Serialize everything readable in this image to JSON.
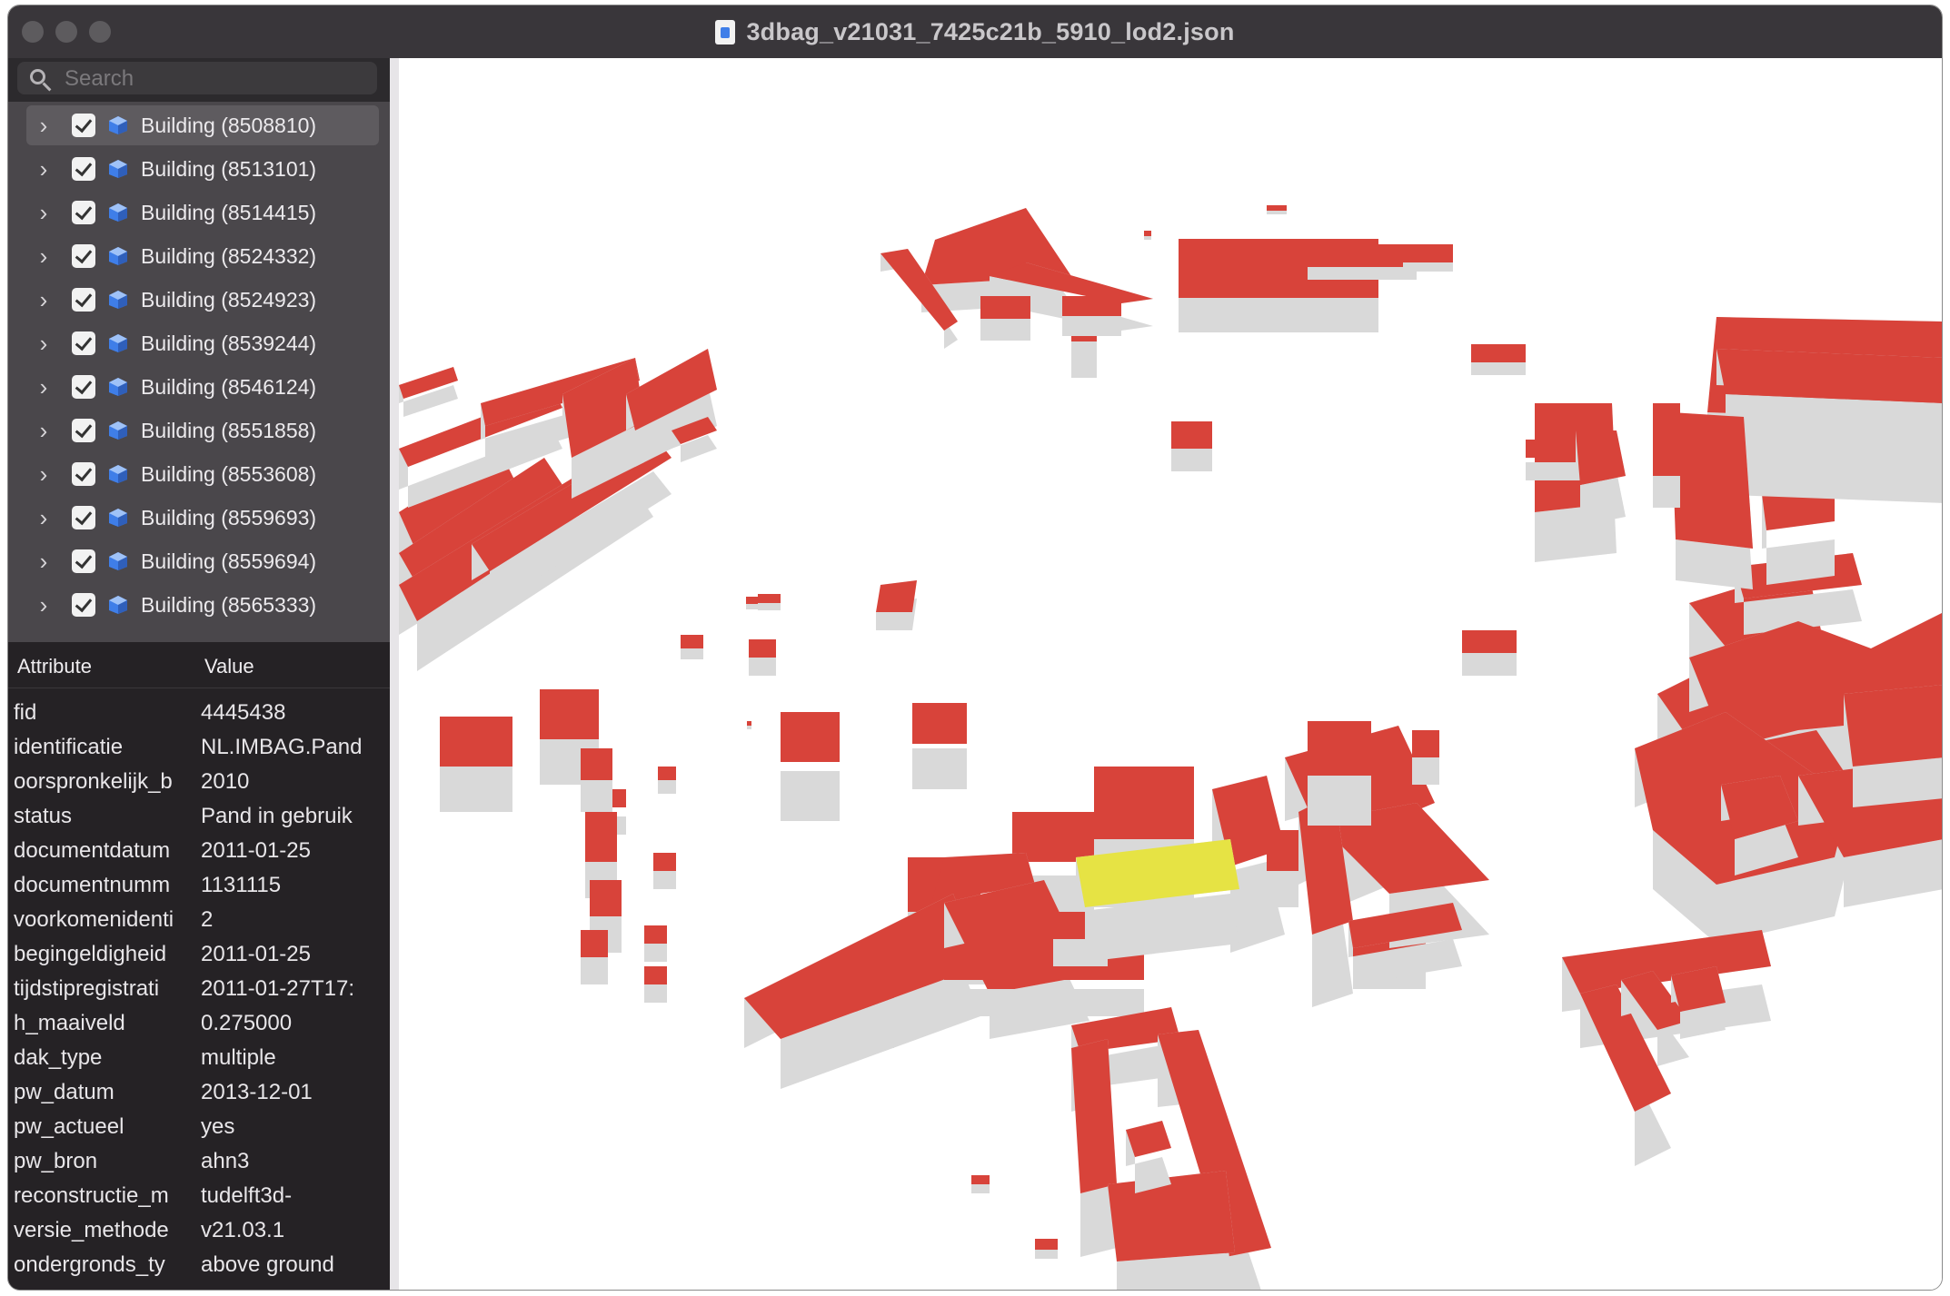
{
  "window": {
    "title": "3dbag_v21031_7425c21b_5910_lod2.json",
    "title_icon": "document-icon"
  },
  "search": {
    "placeholder": "Search",
    "value": ""
  },
  "tree": {
    "items": [
      {
        "label": "Building (8508810)",
        "checked": true,
        "selected": true
      },
      {
        "label": "Building (8513101)",
        "checked": true
      },
      {
        "label": "Building (8514415)",
        "checked": true
      },
      {
        "label": "Building (8524332)",
        "checked": true
      },
      {
        "label": "Building (8524923)",
        "checked": true
      },
      {
        "label": "Building (8539244)",
        "checked": true
      },
      {
        "label": "Building (8546124)",
        "checked": true
      },
      {
        "label": "Building (8551858)",
        "checked": true
      },
      {
        "label": "Building (8553608)",
        "checked": true
      },
      {
        "label": "Building (8559693)",
        "checked": true
      },
      {
        "label": "Building (8559694)",
        "checked": true
      },
      {
        "label": "Building (8565333)",
        "checked": true
      }
    ]
  },
  "attributes": {
    "col_attribute": "Attribute",
    "col_value": "Value",
    "rows": [
      {
        "k": "fid",
        "v": "4445438"
      },
      {
        "k": "identificatie",
        "v": "NL.IMBAG.Pand"
      },
      {
        "k": "oorspronkelijk_b",
        "v": "2010"
      },
      {
        "k": "status",
        "v": "Pand in gebruik"
      },
      {
        "k": "documentdatum",
        "v": "2011-01-25"
      },
      {
        "k": "documentnumm",
        "v": "1131115"
      },
      {
        "k": "voorkomenidenti",
        "v": "2"
      },
      {
        "k": "begingeldigheid",
        "v": "2011-01-25"
      },
      {
        "k": "tijdstipregistrati",
        "v": "2011-01-27T17:"
      },
      {
        "k": "h_maaiveld",
        "v": "0.275000"
      },
      {
        "k": "dak_type",
        "v": "multiple"
      },
      {
        "k": "pw_datum",
        "v": "2013-12-01"
      },
      {
        "k": "pw_actueel",
        "v": "yes"
      },
      {
        "k": "pw_bron",
        "v": "ahn3"
      },
      {
        "k": "reconstructie_m",
        "v": "tudelft3d-"
      },
      {
        "k": "versie_methode",
        "v": "v21.03.1"
      },
      {
        "k": "ondergronds_ty",
        "v": "above ground"
      }
    ]
  },
  "colors": {
    "roof": "#d8433a",
    "roof_highlight": "#e6e344",
    "wall": "#d9d9d9",
    "sidebar_bg": "#2c2a2d",
    "tree_bg": "#4a474b"
  }
}
